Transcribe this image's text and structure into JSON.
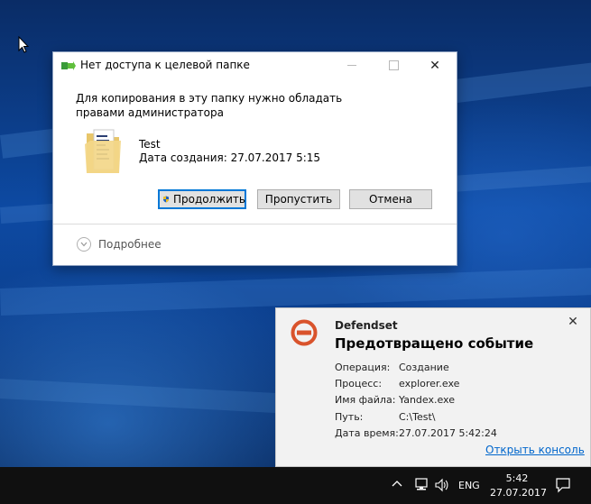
{
  "dialog": {
    "title": "Нет доступа к целевой папке",
    "message": "Для копирования в эту папку нужно обладать правами администратора",
    "file_name": "Test",
    "file_date": "Дата создания: 27.07.2017 5:15",
    "buttons": {
      "continue": "Продолжить",
      "skip": "Пропустить",
      "cancel": "Отмена"
    },
    "more_details": "Подробнее",
    "close_glyph": "✕"
  },
  "toast": {
    "app": "Defendset",
    "title": "Предотвращено событие",
    "close_glyph": "✕",
    "rows": [
      {
        "key": "Операция:",
        "value": "Создание"
      },
      {
        "key": "Процесс:",
        "value": "explorer.exe"
      },
      {
        "key": "Имя файла:",
        "value": "Yandex.exe"
      },
      {
        "key": "Путь:",
        "value": "C:\\Test\\"
      },
      {
        "key": "Дата время:",
        "value": "27.07.2017 5:42:24"
      }
    ],
    "link": "Открыть консоль",
    "icon_color": "#d9532c"
  },
  "taskbar": {
    "language": "ENG",
    "time": "5:42",
    "date": "27.07.2017"
  },
  "colors": {
    "accent": "#0078d7",
    "taskbar": "#101010",
    "link": "#0066cc"
  }
}
